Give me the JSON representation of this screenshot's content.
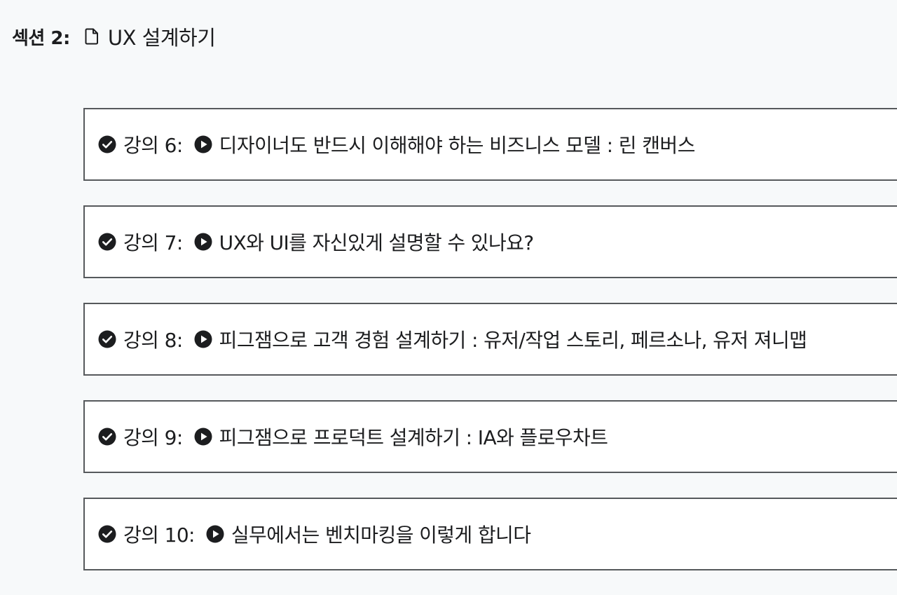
{
  "section": {
    "prefix": "섹션 2:",
    "icon": "document-icon",
    "title": "UX 설계하기"
  },
  "lectures": [
    {
      "label": "강의 6:",
      "title": "디자이너도 반드시 이해해야 하는 비즈니스 모델 : 린 캔버스",
      "status_icon": "check-circle-icon",
      "type_icon": "play-circle-icon"
    },
    {
      "label": "강의 7:",
      "title": "UX와 UI를 자신있게 설명할 수 있나요?",
      "status_icon": "check-circle-icon",
      "type_icon": "play-circle-icon"
    },
    {
      "label": "강의 8:",
      "title": "피그잼으로 고객 경험 설계하기 : 유저/작업 스토리, 페르소나, 유저 져니맵",
      "status_icon": "check-circle-icon",
      "type_icon": "play-circle-icon"
    },
    {
      "label": "강의 9:",
      "title": "피그잼으로 프로덕트 설계하기 : IA와 플로우차트",
      "status_icon": "check-circle-icon",
      "type_icon": "play-circle-icon"
    },
    {
      "label": "강의 10:",
      "title": "실무에서는 벤치마킹을 이렇게 합니다",
      "status_icon": "check-circle-icon",
      "type_icon": "play-circle-icon"
    }
  ]
}
